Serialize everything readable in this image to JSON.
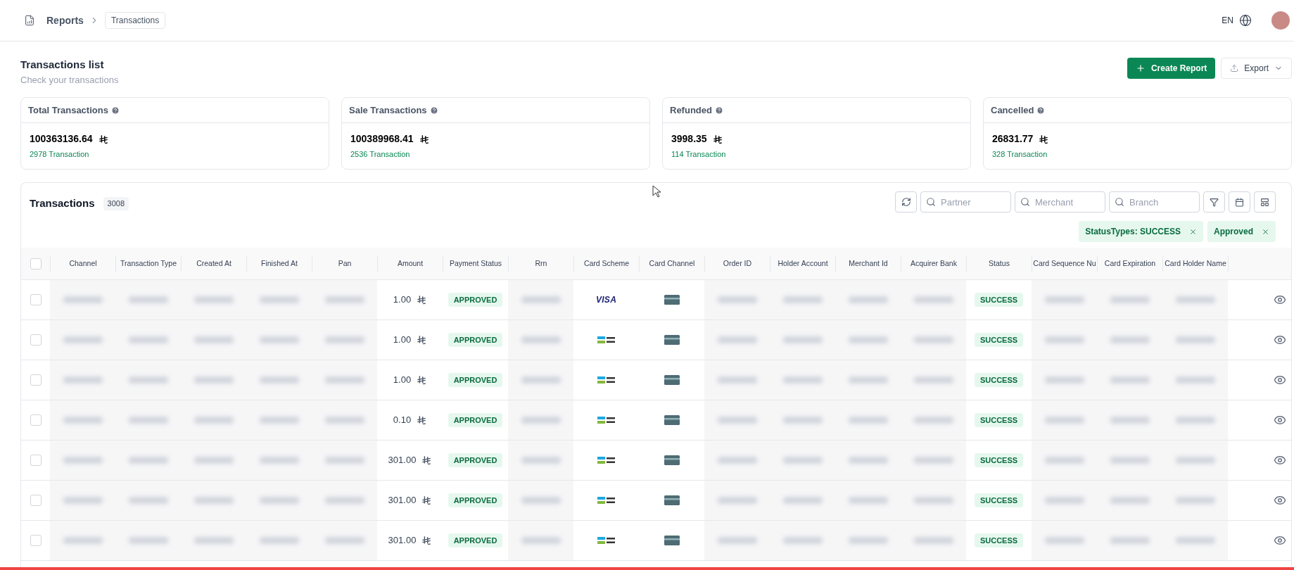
{
  "breadcrumb": {
    "parent": "Reports",
    "current": "Transactions"
  },
  "top_bar": {
    "language": "EN"
  },
  "page": {
    "title": "Transactions list",
    "subtitle": "Check your transactions"
  },
  "actions": {
    "create": "Create Report",
    "export": "Export"
  },
  "summary_cards": [
    {
      "title": "Total Transactions",
      "amount": "100363136.64",
      "count": "2978 Transaction"
    },
    {
      "title": "Sale Transactions",
      "amount": "100389968.41",
      "count": "2536 Transaction"
    },
    {
      "title": "Refunded",
      "amount": "3998.35",
      "count": "114 Transaction"
    },
    {
      "title": "Cancelled",
      "amount": "26831.77",
      "count": "328 Transaction"
    }
  ],
  "table_panel": {
    "title": "Transactions",
    "count": "3008",
    "select_all": {
      "checked": false
    },
    "filters": [
      {
        "placeholder": "Partner"
      },
      {
        "placeholder": "Merchant"
      },
      {
        "placeholder": "Branch"
      }
    ],
    "chips": [
      {
        "label": "StatusTypes: SUCCESS"
      },
      {
        "label": "Approved"
      }
    ]
  },
  "columns": [
    {
      "label": "Channel",
      "kind": "redacted"
    },
    {
      "label": "Transaction Type",
      "kind": "redacted"
    },
    {
      "label": "Created At",
      "kind": "redacted"
    },
    {
      "label": "Finished At",
      "kind": "redacted"
    },
    {
      "label": "Pan",
      "kind": "redacted"
    },
    {
      "label": "Amount",
      "kind": "amount"
    },
    {
      "label": "Payment Status",
      "kind": "payment_status"
    },
    {
      "label": "Rrn",
      "kind": "redacted"
    },
    {
      "label": "Card Scheme",
      "kind": "scheme"
    },
    {
      "label": "Card Channel",
      "kind": "card_channel"
    },
    {
      "label": "Order ID",
      "kind": "redacted"
    },
    {
      "label": "Holder Account",
      "kind": "redacted"
    },
    {
      "label": "Merchant Id",
      "kind": "redacted"
    },
    {
      "label": "Acquirer Bank",
      "kind": "redacted"
    },
    {
      "label": "Status",
      "kind": "status"
    },
    {
      "label": "Card Sequence Nu",
      "kind": "redacted"
    },
    {
      "label": "Card Expiration",
      "kind": "redacted"
    },
    {
      "label": "Card Holder Name",
      "kind": "redacted"
    }
  ],
  "rows": [
    {
      "checked": false,
      "amount": "1.00",
      "payment_status": "APPROVED",
      "scheme": {
        "kind": "visa",
        "label": "VISA"
      },
      "status": "SUCCESS"
    },
    {
      "checked": false,
      "amount": "1.00",
      "payment_status": "APPROVED",
      "scheme": {
        "kind": "mada"
      },
      "status": "SUCCESS"
    },
    {
      "checked": false,
      "amount": "1.00",
      "payment_status": "APPROVED",
      "scheme": {
        "kind": "mada"
      },
      "status": "SUCCESS"
    },
    {
      "checked": false,
      "amount": "0.10",
      "payment_status": "APPROVED",
      "scheme": {
        "kind": "mada"
      },
      "status": "SUCCESS"
    },
    {
      "checked": false,
      "amount": "301.00",
      "payment_status": "APPROVED",
      "scheme": {
        "kind": "mada"
      },
      "status": "SUCCESS"
    },
    {
      "checked": false,
      "amount": "301.00",
      "payment_status": "APPROVED",
      "scheme": {
        "kind": "mada"
      },
      "status": "SUCCESS"
    },
    {
      "checked": false,
      "amount": "301.00",
      "payment_status": "APPROVED",
      "scheme": {
        "kind": "mada"
      },
      "status": "SUCCESS"
    }
  ]
}
